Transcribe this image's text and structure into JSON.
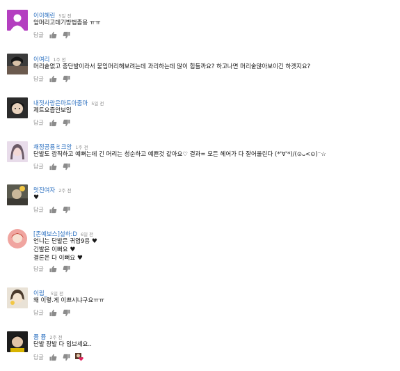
{
  "reply_label": "답글",
  "icons": {
    "like": "thumbs-up-icon",
    "dislike": "thumbs-down-icon",
    "creator_heart": "creator-heart-icon"
  },
  "colors": {
    "author": "#2a6fc0",
    "meta": "#8c8c8c",
    "text": "#111111",
    "heart": "#e0245e"
  },
  "comments": [
    {
      "author": "이이혜린",
      "time": "5일 전",
      "lines": [
        "앞머리고데기방법좀용 ㅠㅠ"
      ]
    },
    {
      "author": "이여리",
      "time": "1주 전",
      "lines": [
        "머리숱없고 중단발이라서 붙임머리해보려는데 과리하는데 많이 힘들까요? 하고나면 머리숱많아보이긴 하겟지요?"
      ]
    },
    {
      "author": "내젓사랑은마트아줌마",
      "time": "5일 전",
      "lines": [
        "제트요즘안보임"
      ]
    },
    {
      "author": "채정공룡ミ크앙",
      "time": "1주 전",
      "lines": [
        "단발도 깜직하고 예뻐는데 긴 머리는 청순하고 예쁜것 같아요♡  결과= 모든 헤어가 다 잘어울린다 (*'∀'*)/(⊙ᴗ<⊙)⁻☆"
      ]
    },
    {
      "author": "멋진여자",
      "time": "2주 전",
      "lines": [
        "♥"
      ]
    },
    {
      "author": "[존예보스]설하:D",
      "time": "6일 전",
      "lines": [
        "언니는 단발은 귀엽9용",
        "긴발은 이뻐요",
        "결론은 다 이뻐요"
      ]
    },
    {
      "author": "이림_",
      "time": "5일 전",
      "lines": [
        "왜 이렇.게 이쁘시냐구요ㅠㅠ"
      ]
    },
    {
      "author": "퓸 퓸",
      "time": "2주 전",
      "lines": [
        "단발 장발 다 입브세요.."
      ]
    }
  ]
}
